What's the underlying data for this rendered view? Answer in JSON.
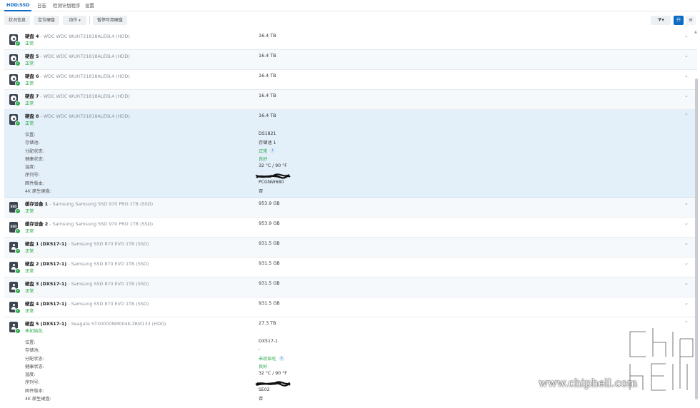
{
  "tabs": [
    {
      "label": "HDD/SSD",
      "active": true
    },
    {
      "label": "日志",
      "active": false
    },
    {
      "label": "检测计划程序",
      "active": false
    },
    {
      "label": "设置",
      "active": false
    }
  ],
  "toolbar": {
    "health_info": "状况信息",
    "locate": "定位硬盘",
    "action": "动作",
    "deactivate": "暂停可用硬盘"
  },
  "disks": [
    {
      "name": "硬盘 4",
      "model": " - WDC WDC WUH721818ALE6L4 (HDD)",
      "status": "正常",
      "size": "16.4 TB",
      "kind": "hdd"
    },
    {
      "name": "硬盘 5",
      "model": " - WDC WDC WUH721818ALE6L4 (HDD)",
      "status": "正常",
      "size": "16.4 TB",
      "kind": "hdd"
    },
    {
      "name": "硬盘 6",
      "model": " - WDC WDC WUH721818ALE6L4 (HDD)",
      "status": "正常",
      "size": "16.4 TB",
      "kind": "hdd"
    },
    {
      "name": "硬盘 7",
      "model": " - WDC WDC WUH721818ALE6L4 (HDD)",
      "status": "正常",
      "size": "16.4 TB",
      "kind": "hdd"
    },
    {
      "name": "硬盘 8",
      "model": " - WDC WDC WUH721818ALE6L4 (HDD)",
      "status": "正常",
      "size": "16.4 TB",
      "kind": "hdd"
    },
    {
      "name": "缓存设备 1",
      "model": " - Samsung Samsung SSD 970 PRO 1TB (SSD)",
      "status": "正常",
      "size": "953.9 GB",
      "kind": "ssd"
    },
    {
      "name": "缓存设备 2",
      "model": " - Samsung Samsung SSD 970 PRO 1TB (SSD)",
      "status": "正常",
      "size": "953.9 GB",
      "kind": "ssd"
    },
    {
      "name": "硬盘 1 (DX517-1)",
      "model": " - Samsung SSD 870 EVO 1TB (SSD)",
      "status": "正常",
      "size": "931.5 GB",
      "kind": "ext"
    },
    {
      "name": "硬盘 2 (DX517-1)",
      "model": " - Samsung SSD 870 EVO 1TB (SSD)",
      "status": "正常",
      "size": "931.5 GB",
      "kind": "ext"
    },
    {
      "name": "硬盘 3 (DX517-1)",
      "model": " - Samsung SSD 870 EVO 1TB (SSD)",
      "status": "正常",
      "size": "931.5 GB",
      "kind": "ext"
    },
    {
      "name": "硬盘 4 (DX517-1)",
      "model": " - Samsung SSD 870 EVO 1TB (SSD)",
      "status": "正常",
      "size": "931.5 GB",
      "kind": "ext"
    },
    {
      "name": "硬盘 5 (DX517-1)",
      "model": " - Seagate ST30000NM004K-3RM133 (HDD)",
      "status": "未初始化",
      "size": "27.3 TB",
      "kind": "ext"
    }
  ],
  "detail_labels": {
    "location": "位置:",
    "pool": "存储池:",
    "alloc": "分配状态:",
    "health": "健康状态:",
    "temp": "温度:",
    "serial": "序列号:",
    "firmware": "固件版本:",
    "native4k": "4K 原生硬盘:"
  },
  "details_disk8": {
    "location": "DS1821",
    "pool": "存储池 1",
    "alloc": "正常",
    "health": "良好",
    "temp": "32 °C / 90 °F",
    "firmware": "PCGNW680",
    "native4k": "否"
  },
  "details_dx5": {
    "location": "DX517-1",
    "pool": "-",
    "alloc": "未初始化",
    "health": "良好",
    "temp": "32 °C / 90 °F",
    "firmware": "SE02",
    "native4k": "否"
  },
  "watermark": {
    "text": "www.chiphell.com"
  },
  "colors": {
    "accent": "#0c6bc3",
    "ok_green": "#2aa74a",
    "expanded_row": "#e3eff9"
  }
}
